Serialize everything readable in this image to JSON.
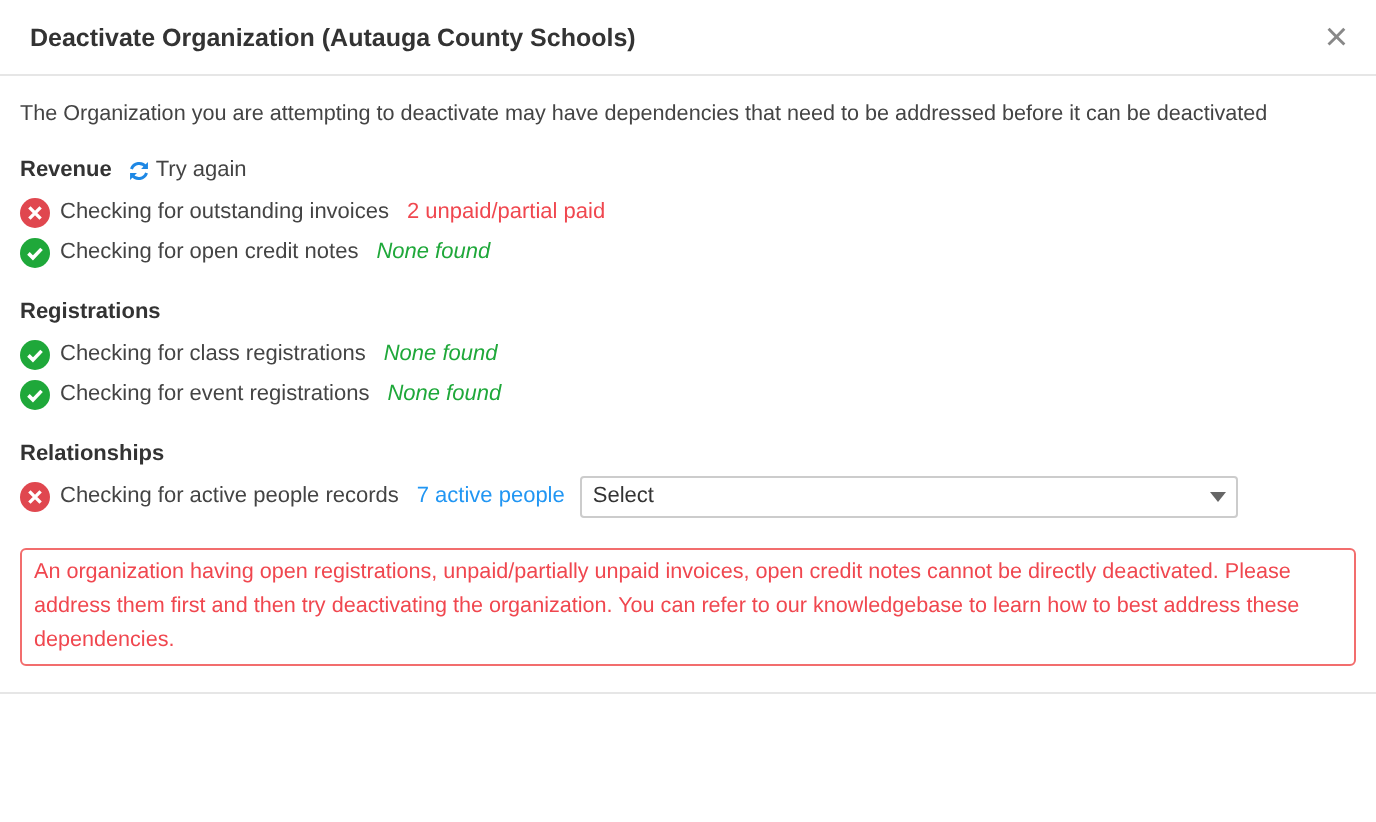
{
  "dialog": {
    "title": "Deactivate Organization (Autauga County Schools)",
    "close": "×"
  },
  "intro": "The Organization you are attempting to deactivate may have dependencies that need to be addressed before it can be deactivated",
  "sections": [
    {
      "title": "Revenue",
      "action": "Try again",
      "checks": [
        {
          "passed": false,
          "label": "Checking for outstanding invoices",
          "result": "2 unpaid/partial paid",
          "kind": "error"
        },
        {
          "passed": true,
          "label": "Checking for open credit notes",
          "result": "None found",
          "kind": "none"
        }
      ]
    },
    {
      "title": "Registrations",
      "checks": [
        {
          "passed": true,
          "label": "Checking for class registrations",
          "result": "None found",
          "kind": "none"
        },
        {
          "passed": true,
          "label": "Checking for event registrations",
          "result": "None found",
          "kind": "none"
        }
      ]
    },
    {
      "title": "Relationships",
      "checks": [
        {
          "passed": false,
          "label": "Checking for active people records",
          "result": "7 active people",
          "kind": "link",
          "select": {
            "placeholder": "Select"
          }
        }
      ]
    }
  ],
  "alert": "An organization having open registrations, unpaid/partially unpaid invoices, open credit notes cannot be directly deactivated. Please address them first and then try deactivating the organization. You can refer to our knowledgebase to learn how to best address these dependencies."
}
